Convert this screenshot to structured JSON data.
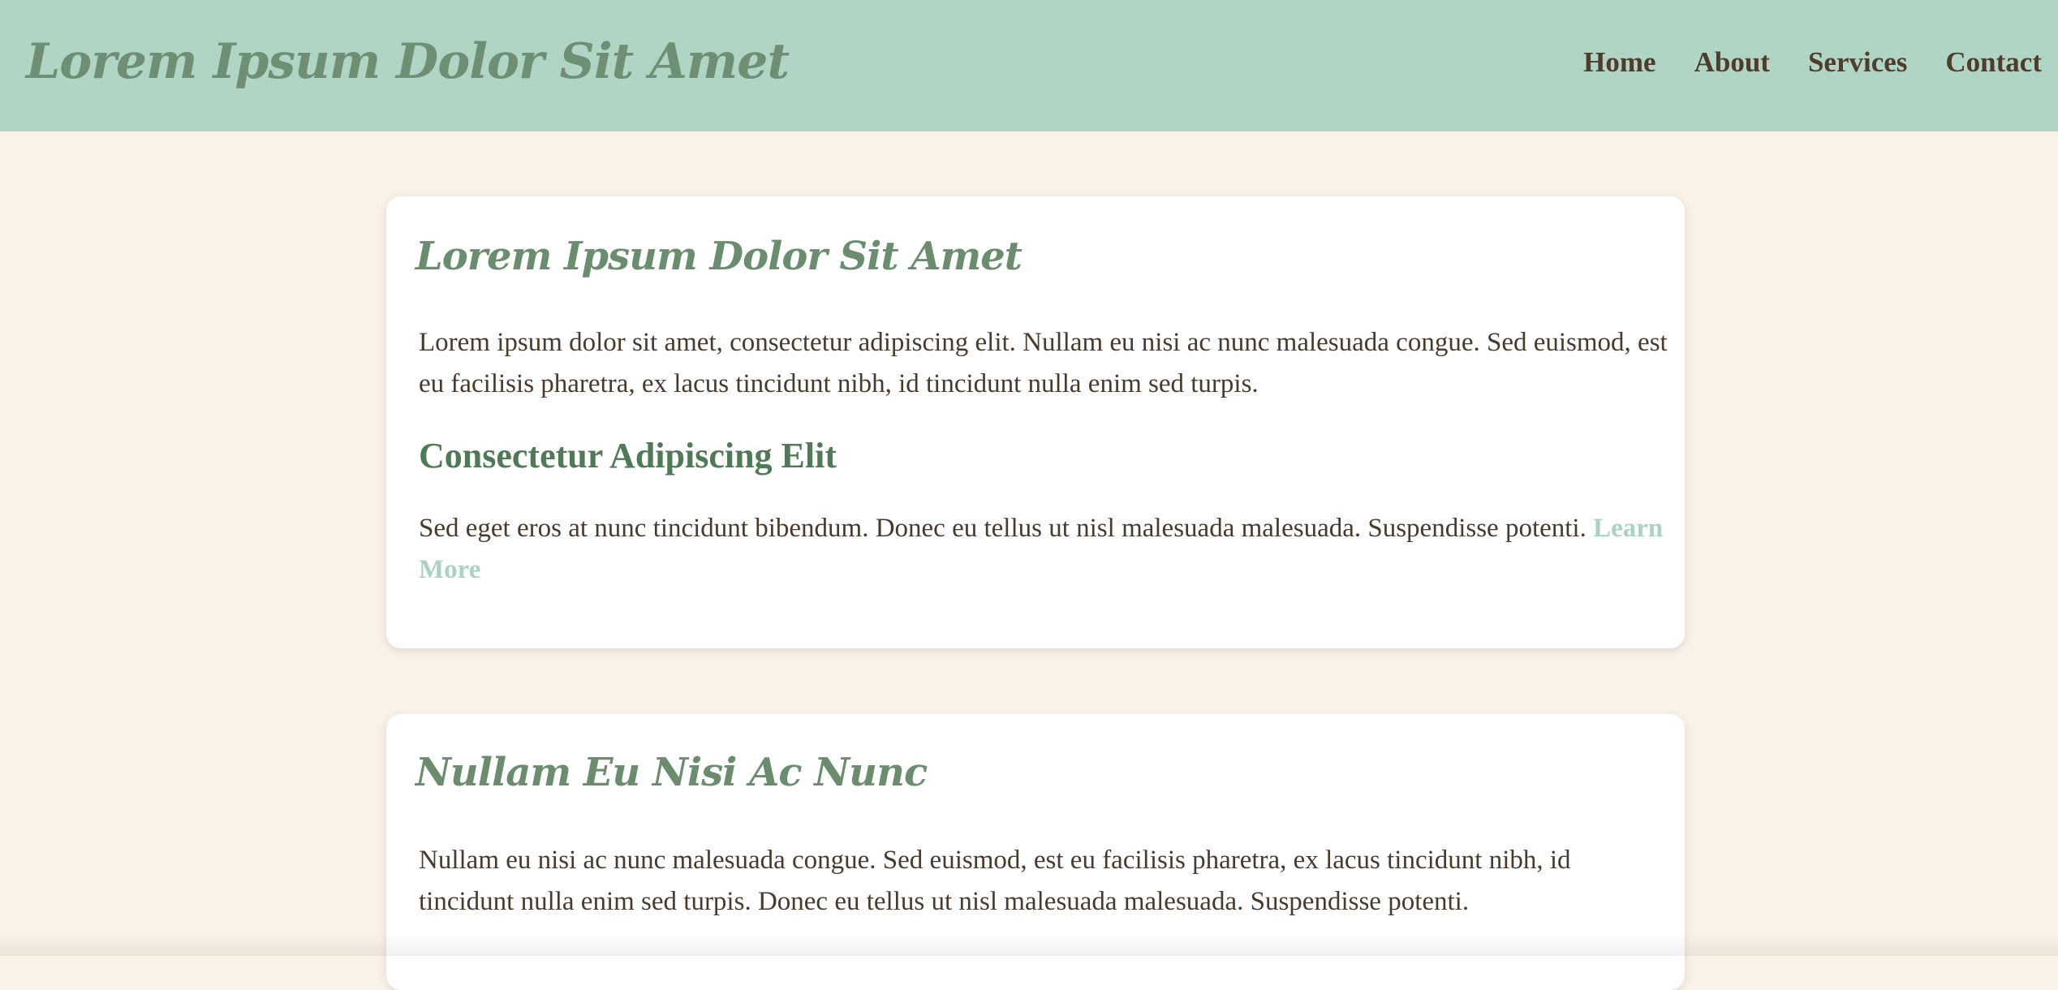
{
  "header": {
    "site_title": "Lorem Ipsum Dolor Sit Amet",
    "nav": [
      {
        "label": "Home"
      },
      {
        "label": "About"
      },
      {
        "label": "Services"
      },
      {
        "label": "Contact"
      }
    ]
  },
  "main": {
    "cards": [
      {
        "title": "Lorem Ipsum Dolor Sit Amet",
        "paragraph1": "Lorem ipsum dolor sit amet, consectetur adipiscing elit. Nullam eu nisi ac nunc malesuada congue. Sed euismod, est eu facilisis pharetra, ex lacus tincidunt nibh, id tincidunt nulla enim sed turpis.",
        "subheading": "Consectetur Adipiscing Elit",
        "paragraph2": "Sed eget eros at nunc tincidunt bibendum. Donec eu tellus ut nisl malesuada malesuada. Suspendisse potenti.",
        "link_label": "Learn More"
      },
      {
        "title": "Nullam Eu Nisi Ac Nunc",
        "paragraph1": "Nullam eu nisi ac nunc malesuada congue. Sed euismod, est eu facilisis pharetra, ex lacus tincidunt nibh, id tincidunt nulla enim sed turpis. Donec eu tellus ut nisl malesuada malesuada. Suspendisse potenti."
      }
    ]
  },
  "colors": {
    "header_bg": "#b1d5c4",
    "page_bg": "#faf1e7",
    "title_green": "#6a8d6e",
    "subheading_green": "#4f7a55",
    "link_mint": "#a8d3c1",
    "text_brown": "#4a3a2c"
  }
}
